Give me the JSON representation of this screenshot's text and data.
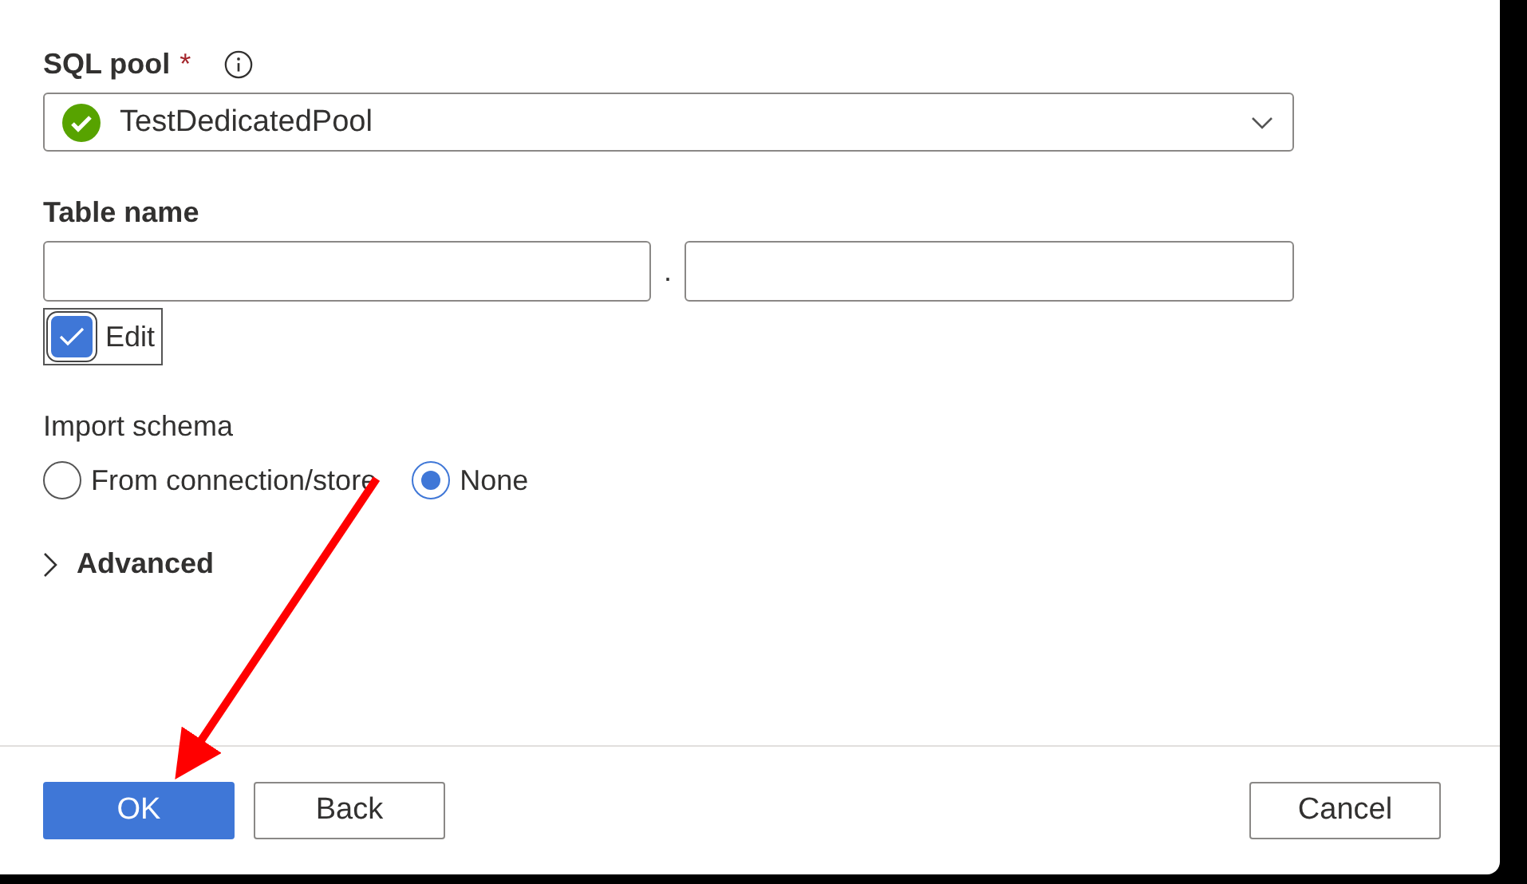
{
  "sql_pool": {
    "label": "SQL pool",
    "required_mark": "*",
    "value": "TestDedicatedPool"
  },
  "table_name": {
    "label": "Table name",
    "separator": ".",
    "edit": {
      "label": "Edit",
      "checked": true
    }
  },
  "import_schema": {
    "label": "Import schema",
    "options": [
      {
        "label": "From connection/store",
        "selected": false
      },
      {
        "label": "None",
        "selected": true
      }
    ]
  },
  "advanced": {
    "label": "Advanced",
    "expanded": false
  },
  "buttons": [
    {
      "label": "OK",
      "kind": "primary"
    },
    {
      "label": "Back",
      "kind": "secondary"
    },
    {
      "label": "Cancel",
      "kind": "cancel"
    }
  ]
}
